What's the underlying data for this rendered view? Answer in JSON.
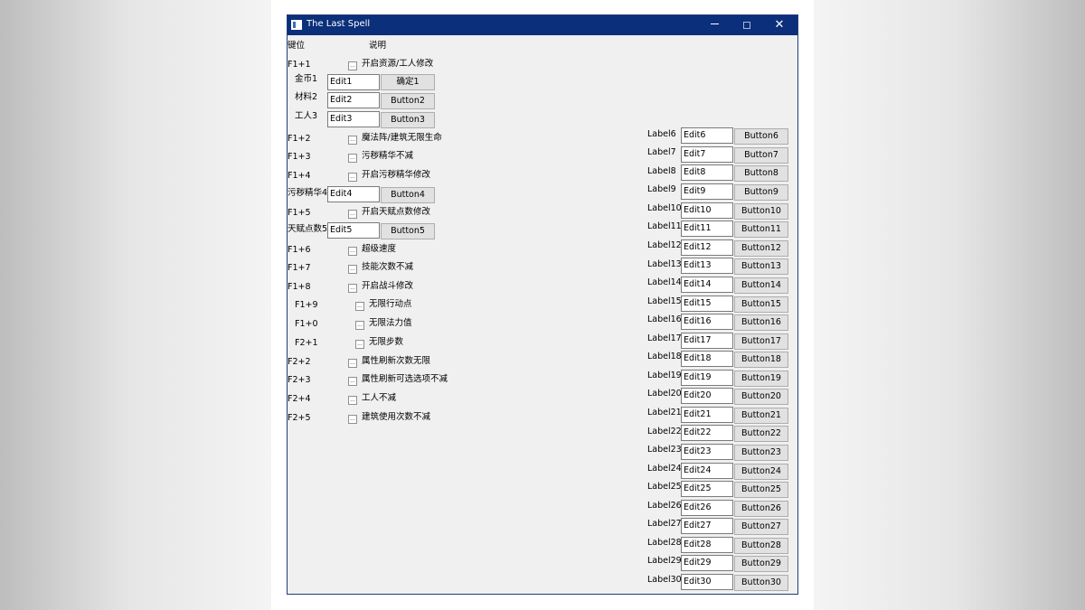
{
  "window": {
    "title": "The Last Spell"
  },
  "headers": {
    "key": "键位",
    "desc": "说明"
  },
  "hotkeys": [
    {
      "key": "F1+1",
      "desc": "开启资源/工人修改"
    },
    {
      "key": "F1+2",
      "desc": "魔法阵/建筑无限生命"
    },
    {
      "key": "F1+3",
      "desc": "污秽精华不减"
    },
    {
      "key": "F1+4",
      "desc": "开启污秽精华修改"
    },
    {
      "key": "F1+5",
      "desc": "开启天赋点数修改"
    },
    {
      "key": "F1+6",
      "desc": "超级速度"
    },
    {
      "key": "F1+7",
      "desc": "技能次数不减"
    },
    {
      "key": "F1+8",
      "desc": "开启战斗修改"
    },
    {
      "key": "F1+9",
      "desc": "无限行动点"
    },
    {
      "key": "F1+0",
      "desc": "无限法力值"
    },
    {
      "key": "F2+1",
      "desc": "无限步数"
    },
    {
      "key": "F2+2",
      "desc": "属性刷新次数无限"
    },
    {
      "key": "F2+3",
      "desc": "属性刷新可选选项不减"
    },
    {
      "key": "F2+4",
      "desc": "工人不减"
    },
    {
      "key": "F2+5",
      "desc": "建筑使用次数不减"
    }
  ],
  "checkbox_glyph": "...",
  "resource_fields": [
    {
      "label": "金币1",
      "edit": "Edit1",
      "button": "确定1"
    },
    {
      "label": "材料2",
      "edit": "Edit2",
      "button": "Button2"
    },
    {
      "label": "工人3",
      "edit": "Edit3",
      "button": "Button3"
    }
  ],
  "essence_field": {
    "label": "污秽精华4",
    "edit": "Edit4",
    "button": "Button4"
  },
  "talent_field": {
    "label": "天赋点数5",
    "edit": "Edit5",
    "button": "Button5"
  },
  "right_fields": [
    {
      "label": "Label6",
      "edit": "Edit6",
      "button": "Button6"
    },
    {
      "label": "Label7",
      "edit": "Edit7",
      "button": "Button7"
    },
    {
      "label": "Label8",
      "edit": "Edit8",
      "button": "Button8"
    },
    {
      "label": "Label9",
      "edit": "Edit9",
      "button": "Button9"
    },
    {
      "label": "Label10",
      "edit": "Edit10",
      "button": "Button10"
    },
    {
      "label": "Label11",
      "edit": "Edit11",
      "button": "Button11"
    },
    {
      "label": "Label12",
      "edit": "Edit12",
      "button": "Button12"
    },
    {
      "label": "Label13",
      "edit": "Edit13",
      "button": "Button13"
    },
    {
      "label": "Label14",
      "edit": "Edit14",
      "button": "Button14"
    },
    {
      "label": "Label15",
      "edit": "Edit15",
      "button": "Button15"
    },
    {
      "label": "Label16",
      "edit": "Edit16",
      "button": "Button16"
    },
    {
      "label": "Label17",
      "edit": "Edit17",
      "button": "Button17"
    },
    {
      "label": "Label18",
      "edit": "Edit18",
      "button": "Button18"
    },
    {
      "label": "Label19",
      "edit": "Edit19",
      "button": "Button19"
    },
    {
      "label": "Label20",
      "edit": "Edit20",
      "button": "Button20"
    },
    {
      "label": "Label21",
      "edit": "Edit21",
      "button": "Button21"
    },
    {
      "label": "Label22",
      "edit": "Edit22",
      "button": "Button22"
    },
    {
      "label": "Label23",
      "edit": "Edit23",
      "button": "Button23"
    },
    {
      "label": "Label24",
      "edit": "Edit24",
      "button": "Button24"
    },
    {
      "label": "Label25",
      "edit": "Edit25",
      "button": "Button25"
    },
    {
      "label": "Label26",
      "edit": "Edit26",
      "button": "Button26"
    },
    {
      "label": "Label27",
      "edit": "Edit27",
      "button": "Button27"
    },
    {
      "label": "Label28",
      "edit": "Edit28",
      "button": "Button28"
    },
    {
      "label": "Label29",
      "edit": "Edit29",
      "button": "Button29"
    },
    {
      "label": "Label30",
      "edit": "Edit30",
      "button": "Button30"
    }
  ],
  "colors": {
    "titlebar": "#0b2f7a",
    "window_bg": "#f0f0f0",
    "button_bg": "#e1e1e1"
  }
}
